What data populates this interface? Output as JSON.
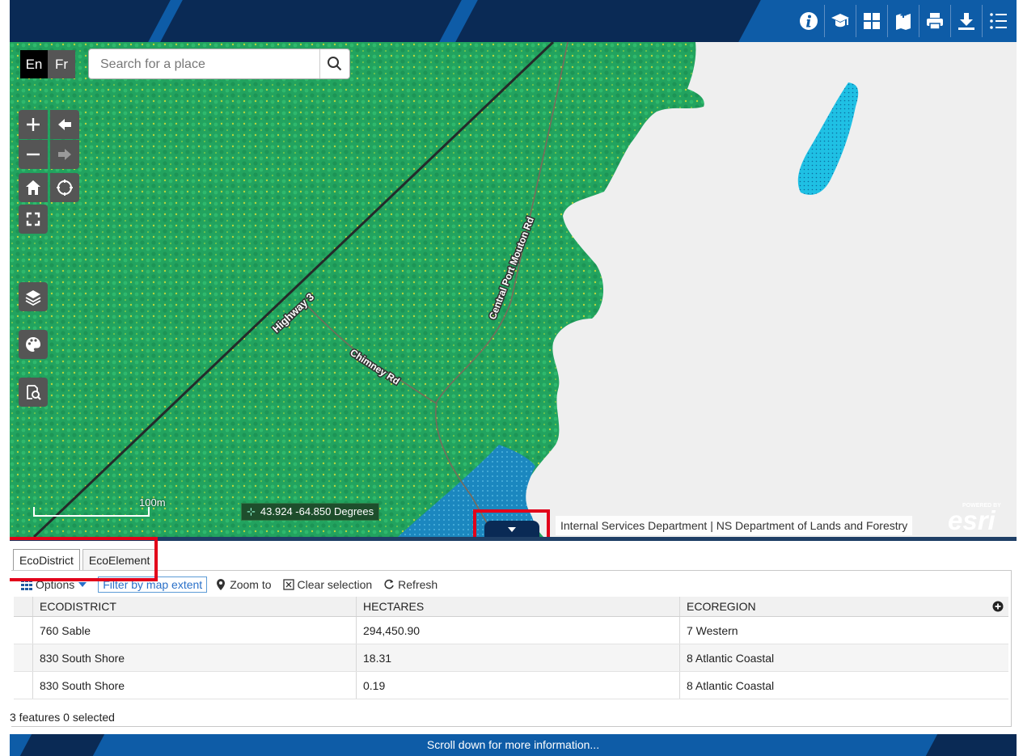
{
  "header": {
    "toolbar": [
      {
        "icon": "info-icon"
      },
      {
        "icon": "graduation-cap-icon"
      },
      {
        "icon": "grid-icon"
      },
      {
        "icon": "bookmark-add-icon"
      },
      {
        "icon": "print-icon"
      },
      {
        "icon": "download-icon"
      },
      {
        "icon": "list-icon"
      }
    ]
  },
  "map": {
    "language": {
      "en": "En",
      "fr": "Fr"
    },
    "search": {
      "placeholder": "Search for a place",
      "value": ""
    },
    "roads": {
      "highway": "Highway 3",
      "central": "Central Port Mouton Rd",
      "chimney": "Chimney Rd"
    },
    "scale_label": "100m",
    "coordinates": "43.924 -64.850 Degrees",
    "attribution": "Internal Services Department | NS Department of Lands and Forestry",
    "logo": {
      "top": "POWERED BY",
      "word": "esri"
    }
  },
  "panel": {
    "tabs": [
      "EcoDistrict",
      "EcoElement"
    ],
    "active_tab": 0,
    "toolbar": {
      "options": "Options",
      "filter": "Filter by map extent",
      "zoom": "Zoom to",
      "clear": "Clear selection",
      "refresh": "Refresh"
    },
    "columns": [
      "ECODISTRICT",
      "HECTARES",
      "ECOREGION"
    ],
    "rows": [
      [
        "760 Sable",
        "294,450.90",
        "7 Western"
      ],
      [
        "830 South Shore",
        "18.31",
        "8 Atlantic Coastal"
      ],
      [
        "830 South Shore",
        "0.19",
        "8 Atlantic Coastal"
      ]
    ],
    "summary": "3 features 0 selected"
  },
  "footer": {
    "text": "Scroll down for more information..."
  },
  "colors": {
    "header": "#0e5ca7",
    "header_dark": "#0a2a55",
    "forest": "#22a35f",
    "water": "#1b87bf",
    "highlight": "#e2001a"
  }
}
